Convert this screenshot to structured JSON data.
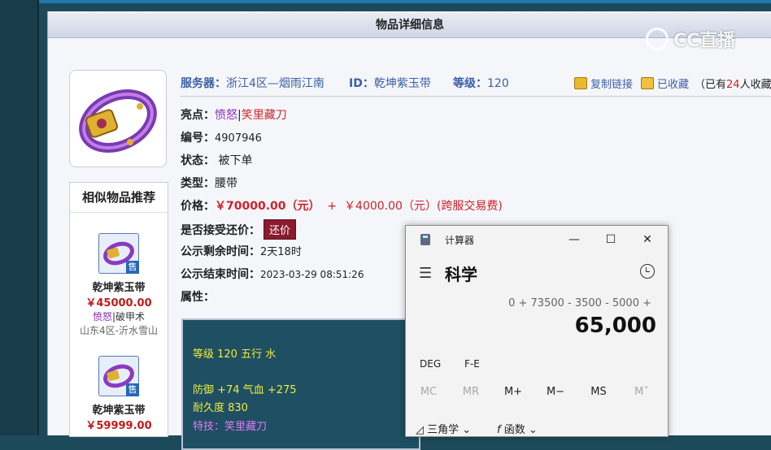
{
  "page": {
    "panel_title": "物品详细信息"
  },
  "header": {
    "server_label": "服务器：",
    "server_value": "浙江4区—烟雨江南",
    "id_label": "ID：",
    "id_value": "乾坤紫玉带",
    "level_label": "等级：",
    "level_value": "120",
    "copy_link": "复制链接",
    "saved": "已收藏",
    "saved_count_prefix": "（已有",
    "saved_count": "24",
    "saved_count_suffix": "人收藏）"
  },
  "details": {
    "highlight_label": "亮点：",
    "highlight_1": "愤怒",
    "highlight_sep": "|",
    "highlight_2": "笑里藏刀",
    "number_label": "编号：",
    "number_value": "4907946",
    "status_label": "状态：",
    "status_value": "被下单",
    "type_label": "类型：",
    "type_value": "腰带",
    "price_label": "价格：",
    "price_value": "￥70000.00（元）",
    "price_plus": "+",
    "fee_value": "￥4000.00（元）(跨服交易费)",
    "haggle_label": "是否接受还价：",
    "haggle_button": "还价",
    "remain_label": "公示剩余时间：",
    "remain_value": "2天18时",
    "end_label": "公示结束时间：",
    "end_value": "2023-03-29 08:51:26",
    "attr_label": "属性："
  },
  "attributes": {
    "line1": "等级 120 五行 水",
    "line2": "防御 +74 气血 +275",
    "line3": "耐久度 830",
    "line4": "特技：笑里藏刀"
  },
  "similar": {
    "title": "相似物品推荐",
    "sale_badge": "售",
    "items": [
      {
        "name": "乾坤紫玉带",
        "price": "￥45000.00",
        "tag1": "愤怒",
        "sep": "|",
        "tag2": "破甲术",
        "server": "山东4区-沂水雪山"
      },
      {
        "name": "乾坤紫玉带",
        "price": "￥59999.00"
      }
    ]
  },
  "calculator": {
    "window_title": "计算器",
    "min": "—",
    "max": "☐",
    "close": "✕",
    "menu": "☰",
    "mode": "科学",
    "expression": "0 + 73500 - 3500 - 5000 +",
    "display": "65,000",
    "deg": "DEG",
    "fe": "F-E",
    "mem": [
      "MC",
      "MR",
      "M+",
      "M−",
      "MS",
      "M˅"
    ],
    "trig": "三角学",
    "func": "函数"
  },
  "watermark": {
    "text": "CC直播"
  },
  "colors": {
    "price_red": "#d0222a",
    "link_blue": "#3a5fa8",
    "haggle_bg": "#8b1a2e",
    "attr_yellow": "#f1ec3a"
  }
}
